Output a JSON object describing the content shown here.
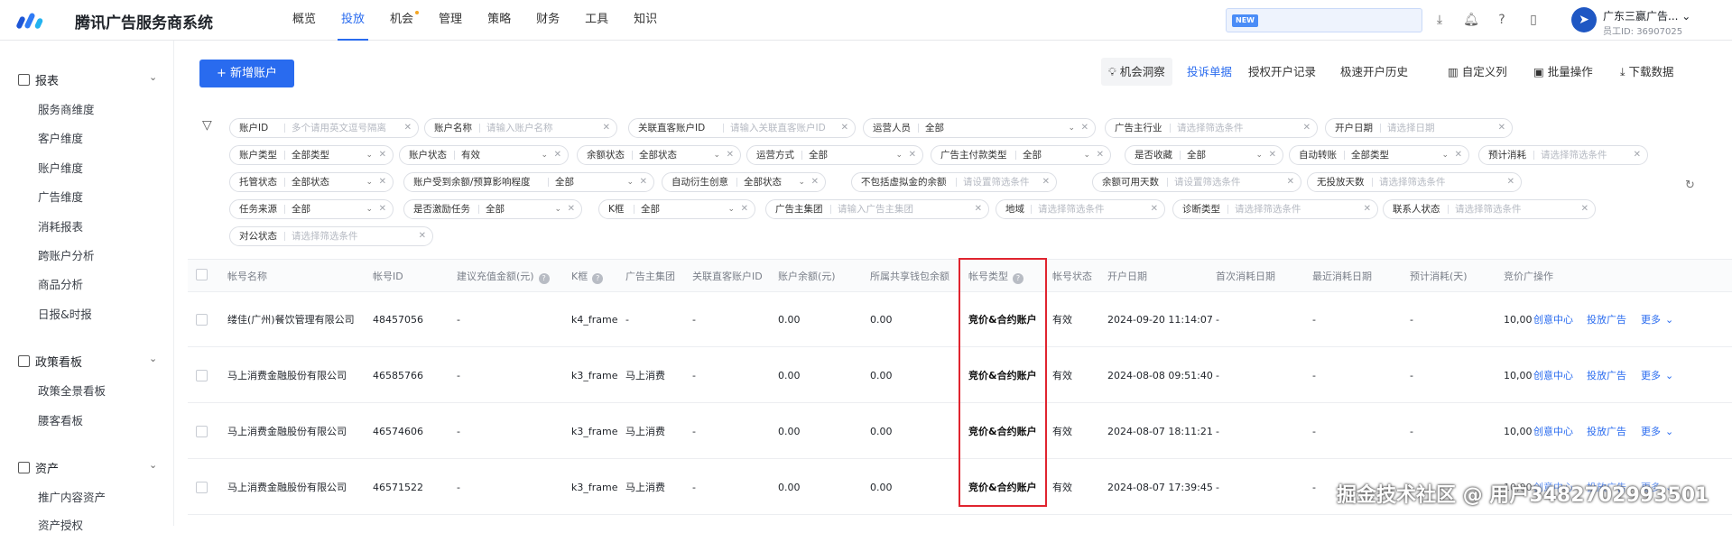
{
  "app": {
    "title": "腾讯广告服务商系统"
  },
  "nav": [
    "概览",
    "投放",
    "机会",
    "管理",
    "策略",
    "财务",
    "工具",
    "知识"
  ],
  "topbar": {
    "new_badge": "NEW",
    "account_name": "广东三赢广告...",
    "employee_id": "员工ID: 36907025"
  },
  "sidebar": {
    "groups": [
      {
        "label": "报表",
        "items": [
          "服务商维度",
          "客户维度",
          "账户维度",
          "广告维度",
          "消耗报表",
          "跨账户分析",
          "商品分析",
          "日报&时报"
        ]
      },
      {
        "label": "政策看板",
        "items": [
          "政策全景看板",
          "腰客看板"
        ]
      },
      {
        "label": "资产",
        "items": [
          "推广内容资产",
          "资产授权"
        ]
      }
    ]
  },
  "toolbar": {
    "new_account": "+ 新增账户",
    "insight": "机会洞察",
    "complaint": "投诉单据",
    "auth_records": "授权开户记录",
    "quick_history": "极速开户历史",
    "custom_cols": "自定义列",
    "batch": "批量操作",
    "download": "下载数据"
  },
  "filters": [
    {
      "label": "账户ID",
      "value": "多个请用英文逗号隔离",
      "ph": true
    },
    {
      "label": "账户名称",
      "value": "请输入账户名称",
      "ph": true
    },
    {
      "label": "关联直客账户ID",
      "value": "请输入关联直客账户ID",
      "ph": true
    },
    {
      "label": "运营人员",
      "value": "全部",
      "ph": false
    },
    {
      "label": "广告主行业",
      "value": "请选择筛选条件",
      "ph": true
    },
    {
      "label": "开户日期",
      "value": "请选择日期",
      "ph": true
    },
    {
      "label": "账户类型",
      "value": "全部类型",
      "ph": false
    },
    {
      "label": "账户状态",
      "value": "有效",
      "ph": false
    },
    {
      "label": "余额状态",
      "value": "全部状态",
      "ph": false
    },
    {
      "label": "运营方式",
      "value": "全部",
      "ph": false
    },
    {
      "label": "广告主付款类型",
      "value": "全部",
      "ph": false
    },
    {
      "label": "是否收藏",
      "value": "全部",
      "ph": false
    },
    {
      "label": "自动转账",
      "value": "全部类型",
      "ph": false
    },
    {
      "label": "预计消耗",
      "value": "请选择筛选条件",
      "ph": true
    },
    {
      "label": "托管状态",
      "value": "全部状态",
      "ph": false
    },
    {
      "label": "账户受到余额/预算影响程度",
      "value": "全部",
      "ph": false
    },
    {
      "label": "自动衍生创意",
      "value": "全部状态",
      "ph": false
    },
    {
      "label": "不包括虚拟金的余额",
      "value": "请设置筛选条件",
      "ph": true
    },
    {
      "label": "余额可用天数",
      "value": "请设置筛选条件",
      "ph": true
    },
    {
      "label": "无投放天数",
      "value": "请选择筛选条件",
      "ph": true
    },
    {
      "label": "任务来源",
      "value": "全部",
      "ph": false
    },
    {
      "label": "是否激励任务",
      "value": "全部",
      "ph": false
    },
    {
      "label": "K框",
      "value": "全部",
      "ph": false
    },
    {
      "label": "广告主集团",
      "value": "请输入广告主集团",
      "ph": true
    },
    {
      "label": "地域",
      "value": "请选择筛选条件",
      "ph": true
    },
    {
      "label": "诊断类型",
      "value": "请选择筛选条件",
      "ph": true
    },
    {
      "label": "联系人状态",
      "value": "请选择筛选条件",
      "ph": true
    },
    {
      "label": "对公状态",
      "value": "请选择筛选条件",
      "ph": true
    }
  ],
  "table": {
    "headers": [
      "帐号名称",
      "帐号ID",
      "建议充值金额(元)",
      "K框",
      "广告主集团",
      "关联直客账户ID",
      "账户余额(元)",
      "所属共享钱包余额",
      "帐号类型",
      "帐号状态",
      "开户日期",
      "首次消耗日期",
      "最近消耗日期",
      "预计消耗(天)",
      "竞价广",
      "操作"
    ],
    "rows": [
      {
        "name": "缕佳(广州)餐饮管理有限公司",
        "id": "48457056",
        "suggest": "-",
        "kframe": "k4_frame",
        "group": "-",
        "linked": "-",
        "balance": "0.00",
        "wallet": "0.00",
        "type": "竞价&合约账户",
        "status": "有效",
        "open_date": "2024-09-20 11:14:07",
        "first": "-",
        "last": "-",
        "est": "-",
        "bid": "10,00"
      },
      {
        "name": "马上消费金融股份有限公司",
        "id": "46585766",
        "suggest": "-",
        "kframe": "k3_frame",
        "group": "马上消费",
        "linked": "-",
        "balance": "0.00",
        "wallet": "0.00",
        "type": "竞价&合约账户",
        "status": "有效",
        "open_date": "2024-08-08 09:51:40",
        "first": "-",
        "last": "-",
        "est": "-",
        "bid": "10,00"
      },
      {
        "name": "马上消费金融股份有限公司",
        "id": "46574606",
        "suggest": "-",
        "kframe": "k3_frame",
        "group": "马上消费",
        "linked": "-",
        "balance": "0.00",
        "wallet": "0.00",
        "type": "竞价&合约账户",
        "status": "有效",
        "open_date": "2024-08-07 18:11:21",
        "first": "-",
        "last": "-",
        "est": "-",
        "bid": "10,00"
      },
      {
        "name": "马上消费金融股份有限公司",
        "id": "46571522",
        "suggest": "-",
        "kframe": "k3_frame",
        "group": "马上消费",
        "linked": "-",
        "balance": "0.00",
        "wallet": "0.00",
        "type": "竞价&合约账户",
        "status": "有效",
        "open_date": "2024-08-07 17:39:45",
        "first": "-",
        "last": "-",
        "est": "-",
        "bid": "10,00"
      }
    ],
    "actions": [
      "创意中心",
      "投放广告",
      "更多"
    ]
  },
  "watermark": "掘金技术社区 @ 用户3482702993501"
}
